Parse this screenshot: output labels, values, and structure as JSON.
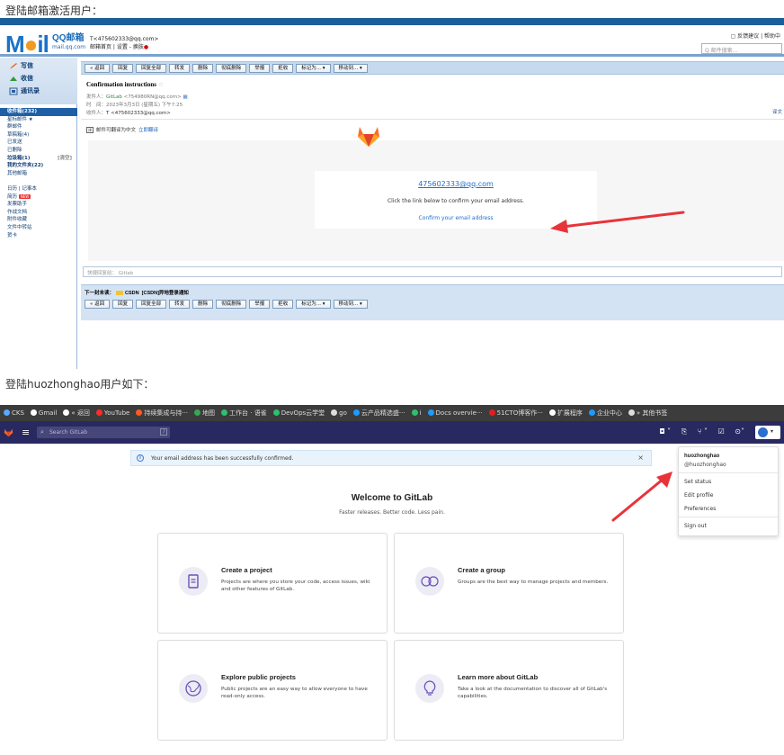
{
  "captions": {
    "first": "登陆邮箱激活用户：",
    "second": "登陆huozhonghao用户如下："
  },
  "qqmail": {
    "logo_text": "M",
    "logo_i": "●",
    "logo_rest": "il",
    "logo_cn": "QQ邮箱",
    "logo_domain": "mail.qq.com",
    "user_line1": "T<475602333@qq.com>",
    "user_line2": "邮箱首页 | 设置 - 换肤",
    "top_links": "反馈建议 | 帮助中",
    "search_placeholder": "Q 邮件搜索...",
    "side_buttons": [
      "写信",
      "收信",
      "通讯录"
    ],
    "folders": [
      {
        "label": "收件箱(232)",
        "active": true
      },
      {
        "label": "星标邮件 ★"
      },
      {
        "label": "群邮件"
      },
      {
        "label": "草稿箱(4)"
      },
      {
        "label": "已发送"
      },
      {
        "label": "已删除"
      },
      {
        "label": "垃圾箱(1)",
        "bold": true,
        "right": "[清空]"
      },
      {
        "label": "我的文件夹(22)",
        "bold": true
      },
      {
        "label": "其他邮箱"
      },
      {
        "label": ""
      },
      {
        "label": "日历 | 记事本"
      },
      {
        "label": "简历",
        "hot": "NEW"
      },
      {
        "label": "发票助手"
      },
      {
        "label": "作战文档"
      },
      {
        "label": "附件收藏"
      },
      {
        "label": "文件中转站"
      },
      {
        "label": "贺卡"
      }
    ],
    "toolbar_buttons": [
      "« 返回",
      "回复",
      "回复全部",
      "转发",
      "删除",
      "彻底删除",
      "举报",
      "拒收",
      "标记为... ▾",
      "移动到... ▾"
    ],
    "subject": "Confirmation instructions",
    "subject_star": "☆",
    "from_label": "发件人：",
    "from_name": "GitLab",
    "from_addr": "<754980RN@qq.com>",
    "time_label": "时　间：",
    "time_value": "2023年3月3日 (星期五) 下午7:25",
    "to_label": "收件人：",
    "to_value": "T <475602333@qq.com>",
    "meta_right": "译文",
    "translate_text": "邮件可翻译为中文",
    "translate_link": "立即翻译",
    "email_link": "475602333@qq.com",
    "email_text": "Click the link below to confirm your email address.",
    "confirm_link": "Confirm your email address",
    "quick_reply": "快捷回复给：   Gitlab",
    "next_label": "下一封未读：",
    "next_source": "CSDN",
    "next_subject": "[CSDN]异地登录通知",
    "icon_names": [
      "compose-icon",
      "inbox-icon",
      "contacts-icon",
      "translate-icon",
      "gitlab-logo-icon"
    ]
  },
  "gitlab": {
    "bookmarks": [
      {
        "label": "CKS",
        "color": "#5aa9ff"
      },
      {
        "label": "Gmail",
        "color": "#ffffff"
      },
      {
        "label": "« 返回",
        "color": "#ffffff"
      },
      {
        "label": "YouTube",
        "color": "#ff2b2b"
      },
      {
        "label": "持续集成与持···",
        "color": "#ff5a1f"
      },
      {
        "label": "地图",
        "color": "#34a853"
      },
      {
        "label": "工作台 · 语雀",
        "color": "#2fbf71"
      },
      {
        "label": "DevOps云学堂",
        "color": "#2fbf71"
      },
      {
        "label": "go",
        "color": "#dddddd"
      },
      {
        "label": "云产品精选盛···",
        "color": "#1e9bff"
      },
      {
        "label": "i",
        "color": "#2fbf71"
      },
      {
        "label": "Docs overvie···",
        "color": "#1e9bff"
      },
      {
        "label": "51CTO博客作···",
        "color": "#e02020"
      },
      {
        "label": "扩展程序",
        "color": "#ffffff"
      },
      {
        "label": "企业中心",
        "color": "#1e9bff"
      },
      {
        "label": "»  其他书签",
        "color": "#dddddd"
      }
    ],
    "search_placeholder": "Search GitLab",
    "search_shortcut": "/",
    "nav_icons": [
      "◘ ˅",
      "⎘",
      "⑂ ˅",
      "☑",
      "⊙˅"
    ],
    "alert": "Your email address has been successfully confirmed.",
    "alert_close": "×",
    "dropdown": {
      "name": "huozhonghao",
      "handle": "@huozhonghao",
      "items": [
        "Set status",
        "Edit profile",
        "Preferences",
        "Sign out"
      ]
    },
    "welcome": "Welcome to GitLab",
    "tagline": "Faster releases. Better code. Less pain.",
    "cards": [
      {
        "title": "Create a project",
        "desc": "Projects are where you store your code, access issues, wiki and other features of GitLab."
      },
      {
        "title": "Create a group",
        "desc": "Groups are the best way to manage projects and members."
      },
      {
        "title": "Explore public projects",
        "desc": "Public projects are an easy way to allow everyone to have read-only access."
      },
      {
        "title": "Learn more about GitLab",
        "desc": "Take a look at the documentation to discover all of GitLab's capabilities."
      }
    ],
    "colors": {
      "navbar": "#292961",
      "alert_bg": "#e9f3fc",
      "annotation_arrow": "#e8333a"
    }
  }
}
